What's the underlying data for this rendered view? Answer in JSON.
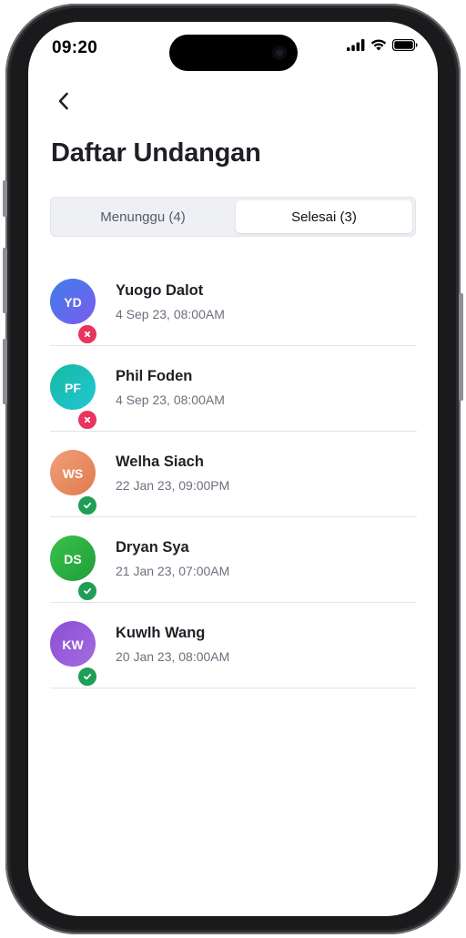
{
  "status_bar": {
    "time": "09:20"
  },
  "page": {
    "title": "Daftar Undangan"
  },
  "tabs": [
    {
      "label": "Menunggu (4)",
      "active": false
    },
    {
      "label": "Selesai (3)",
      "active": true
    }
  ],
  "invitations": [
    {
      "initials": "YD",
      "name": "Yuogo Dalot",
      "date": "4 Sep 23, 08:00AM",
      "status": "rejected",
      "avatar_color_start": "#3f7de8",
      "avatar_color_end": "#7b5cf0"
    },
    {
      "initials": "PF",
      "name": "Phil Foden",
      "date": "4 Sep 23, 08:00AM",
      "status": "rejected",
      "avatar_color_start": "#16b9a0",
      "avatar_color_end": "#22c7d6"
    },
    {
      "initials": "WS",
      "name": "Welha Siach",
      "date": "22 Jan 23, 09:00PM",
      "status": "accepted",
      "avatar_color_start": "#f0a07a",
      "avatar_color_end": "#e07a4f"
    },
    {
      "initials": "DS",
      "name": "Dryan Sya",
      "date": "21 Jan 23, 07:00AM",
      "status": "accepted",
      "avatar_color_start": "#3ac14a",
      "avatar_color_end": "#1f9e3a"
    },
    {
      "initials": "KW",
      "name": "Kuwlh Wang",
      "date": "20 Jan 23, 08:00AM",
      "status": "accepted",
      "avatar_color_start": "#8a4fd6",
      "avatar_color_end": "#a56be0"
    }
  ],
  "colors": {
    "accepted": "#1f9e55",
    "rejected": "#e8345e"
  }
}
